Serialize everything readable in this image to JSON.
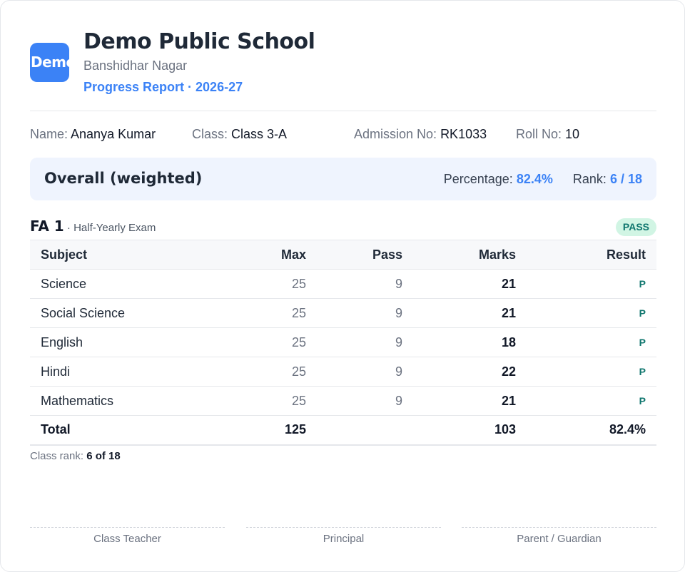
{
  "school": {
    "logo_text": "Demo",
    "name": "Demo Public School",
    "location": "Banshidhar Nagar",
    "report_line": "Progress Report · 2026-27"
  },
  "student": {
    "name_label": "Name:",
    "name": "Ananya Kumar",
    "class_label": "Class:",
    "class": "Class 3-A",
    "admission_label": "Admission No:",
    "admission": "RK1033",
    "roll_label": "Roll No:",
    "roll": "10"
  },
  "overall": {
    "title": "Overall (weighted)",
    "percentage_label": "Percentage:",
    "percentage": "82.4%",
    "rank_label": "Rank:",
    "rank": "6 / 18"
  },
  "exam": {
    "name": "FA 1",
    "sub": " · Half-Yearly Exam",
    "status": "PASS",
    "headers": [
      "Subject",
      "Max",
      "Pass",
      "Marks",
      "Result"
    ],
    "rows": [
      {
        "subject": "Science",
        "max": "25",
        "pass": "9",
        "marks": "21",
        "result": "P"
      },
      {
        "subject": "Social Science",
        "max": "25",
        "pass": "9",
        "marks": "21",
        "result": "P"
      },
      {
        "subject": "English",
        "max": "25",
        "pass": "9",
        "marks": "18",
        "result": "P"
      },
      {
        "subject": "Hindi",
        "max": "25",
        "pass": "9",
        "marks": "22",
        "result": "P"
      },
      {
        "subject": "Mathematics",
        "max": "25",
        "pass": "9",
        "marks": "21",
        "result": "P"
      }
    ],
    "total": {
      "label": "Total",
      "max": "125",
      "pass": "",
      "marks": "103",
      "result": "82.4%"
    },
    "class_rank_label": "Class rank:",
    "class_rank": "6 of 18"
  },
  "signatures": [
    "Class Teacher",
    "Principal",
    "Parent / Guardian"
  ],
  "colors": {
    "accent": "#3b82f6",
    "pass": "#0f766e",
    "overall_bg": "#eff4fe"
  }
}
